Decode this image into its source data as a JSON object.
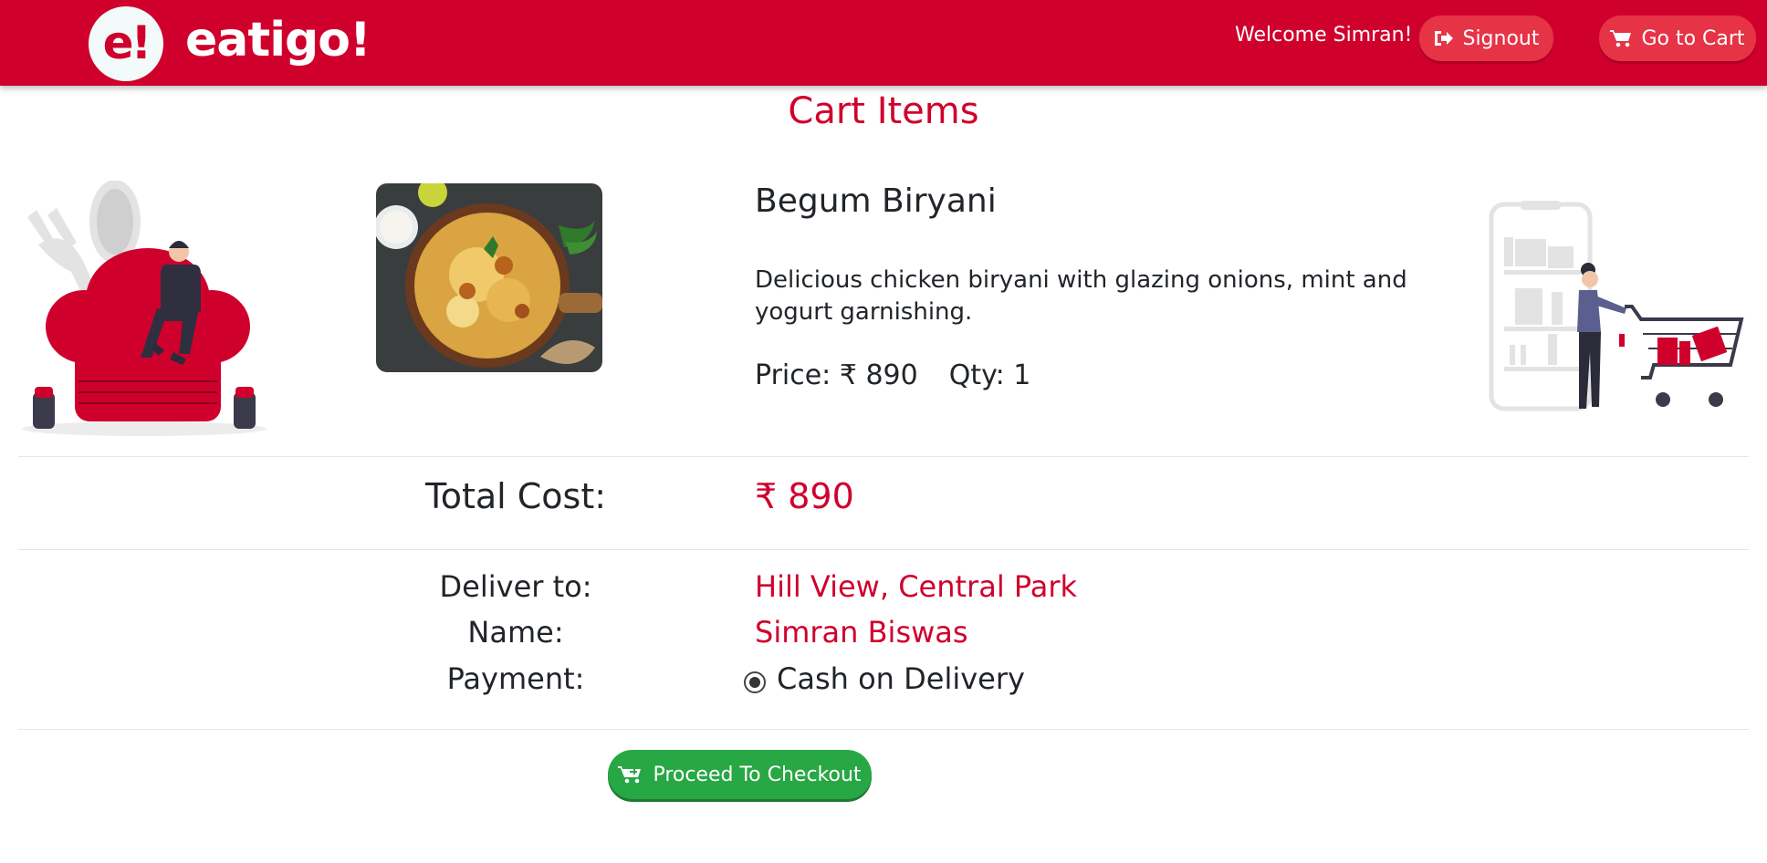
{
  "brand": {
    "logo_mark": "e!",
    "name": "eatigo!",
    "color": "#d0002d"
  },
  "header": {
    "welcome": "Welcome Simran!",
    "signout_label": "Signout",
    "signout_icon": "sign-out-icon",
    "cart_label": "Go to Cart",
    "cart_icon": "cart-icon"
  },
  "page": {
    "title": "Cart Items"
  },
  "cart": {
    "items": [
      {
        "name": "Begum Biryani",
        "description": "Delicious chicken biryani with glazing onions, mint and yogurt garnishing.",
        "price_text": "Price: ₹ 890",
        "qty_text": "Qty: 1",
        "image": "biryani-image"
      }
    ]
  },
  "summary": {
    "total_label": "Total Cost:",
    "total_value": "₹ 890"
  },
  "delivery": {
    "deliver_label": "Deliver to:",
    "deliver_value": "Hill View, Central Park",
    "name_label": "Name:",
    "name_value": "Simran Biswas",
    "payment_label": "Payment:",
    "payment_value": "Cash on Delivery",
    "payment_selected": true
  },
  "checkout": {
    "label": "Proceed To Checkout",
    "icon": "cart-plus-icon",
    "color": "#28a745"
  }
}
